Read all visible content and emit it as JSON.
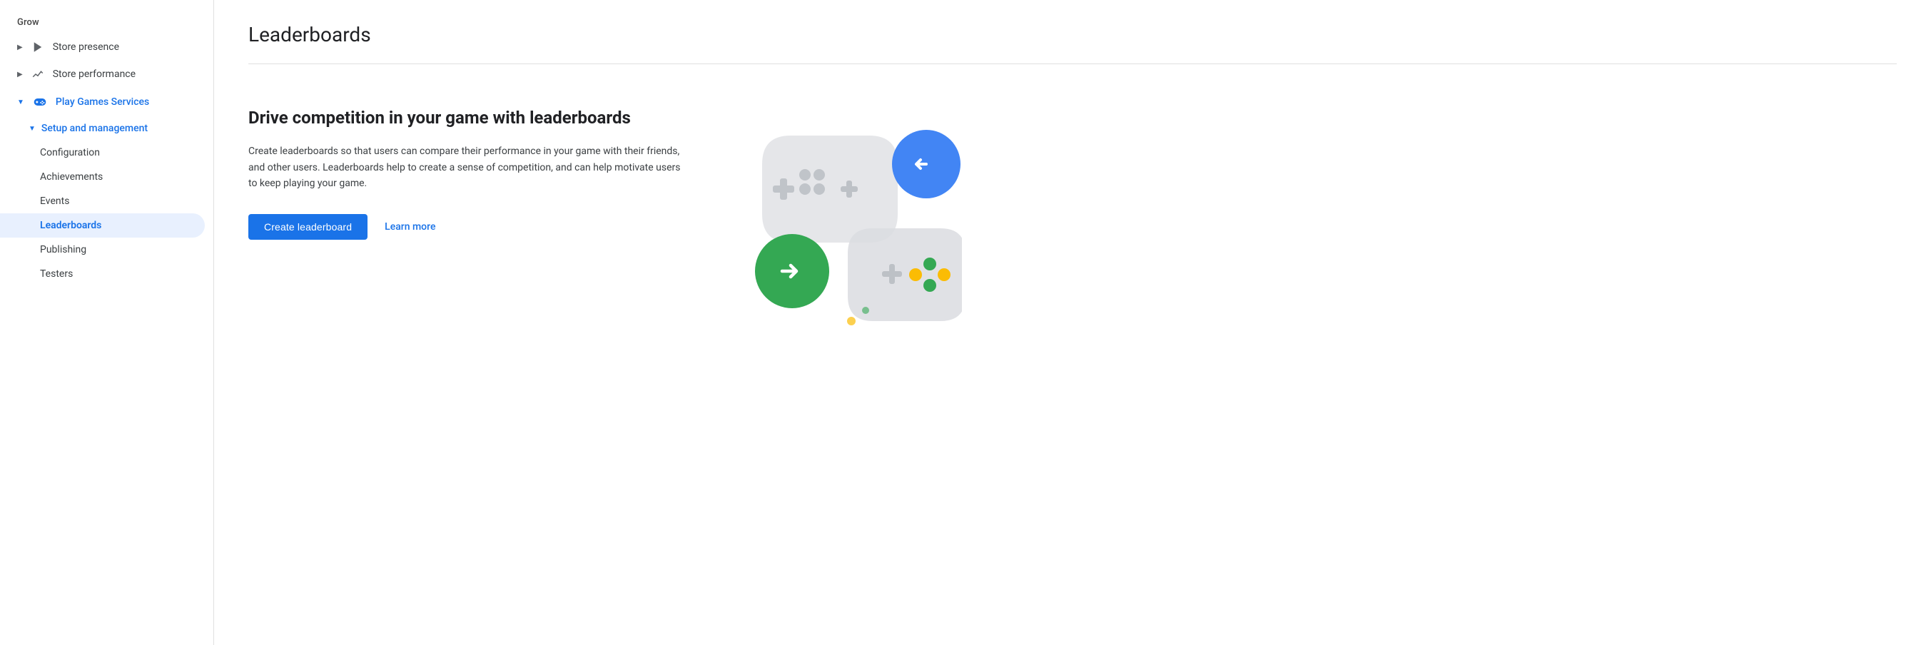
{
  "sidebar": {
    "section_label": "Grow",
    "items": [
      {
        "id": "store-presence",
        "label": "Store presence",
        "icon": "play-icon",
        "has_arrow": true,
        "active": false,
        "expanded": false
      },
      {
        "id": "store-performance",
        "label": "Store performance",
        "icon": "trend-icon",
        "has_arrow": true,
        "active": false,
        "expanded": false
      },
      {
        "id": "play-games-services",
        "label": "Play Games Services",
        "icon": "gamepad-icon",
        "has_arrow": true,
        "active": true,
        "expanded": true
      }
    ],
    "subgroup": {
      "label": "Setup and management",
      "arrow": "down",
      "subitems": [
        {
          "id": "configuration",
          "label": "Configuration",
          "active": false
        },
        {
          "id": "achievements",
          "label": "Achievements",
          "active": false
        },
        {
          "id": "events",
          "label": "Events",
          "active": false
        },
        {
          "id": "leaderboards",
          "label": "Leaderboards",
          "active": true
        },
        {
          "id": "publishing",
          "label": "Publishing",
          "active": false
        },
        {
          "id": "testers",
          "label": "Testers",
          "active": false
        }
      ]
    }
  },
  "main": {
    "title": "Leaderboards",
    "content_heading": "Drive competition in your game with leaderboards",
    "content_body": "Create leaderboards so that users can compare their performance in your game with their friends, and other users. Leaderboards help to create a sense of competition, and can help motivate users to keep playing your game.",
    "create_button": "Create leaderboard",
    "learn_more": "Learn more"
  }
}
